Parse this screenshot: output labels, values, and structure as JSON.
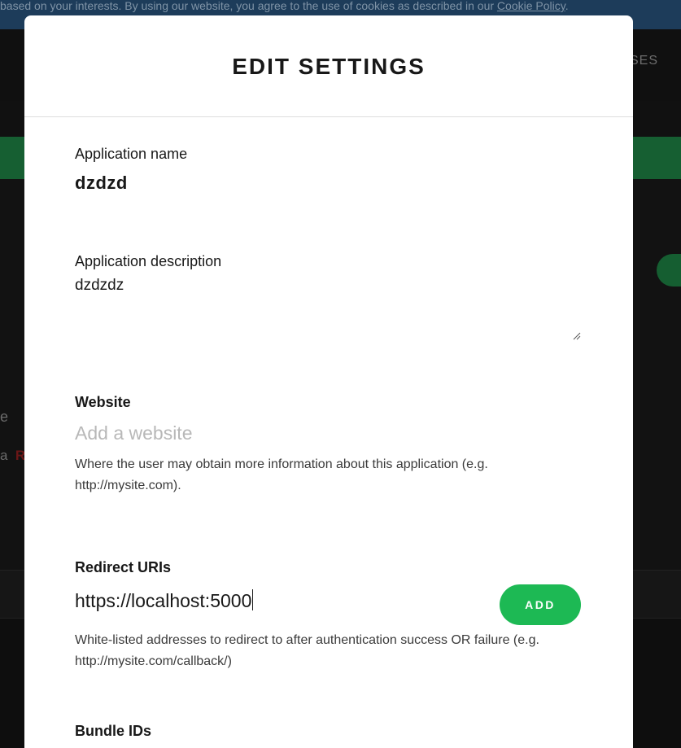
{
  "cookie_bar": {
    "text": "based on your interests. By using our website, you agree to the use of cookies as described in our ",
    "link": "Cookie Policy",
    "period": "."
  },
  "background": {
    "nav_text": "SES",
    "text_e": "e",
    "text_a": "a",
    "text_r": "R"
  },
  "modal": {
    "title": "EDIT SETTINGS",
    "app_name": {
      "label": "Application name",
      "value": "dzdzd"
    },
    "app_description": {
      "label": "Application description",
      "value": "dzdzdz"
    },
    "website": {
      "label": "Website",
      "placeholder": "Add a website",
      "help": "Where the user may obtain more information about this application (e.g. http://mysite.com)."
    },
    "redirect_uris": {
      "label": "Redirect URIs",
      "value": "https://localhost:5000",
      "add_label": "ADD",
      "help": "White-listed addresses to redirect to after authentication success OR failure (e.g. http://mysite.com/callback/)"
    },
    "bundle_ids": {
      "label": "Bundle IDs"
    }
  },
  "colors": {
    "accent_green": "#1db954",
    "overlay_bg": "#0e0e0e"
  }
}
